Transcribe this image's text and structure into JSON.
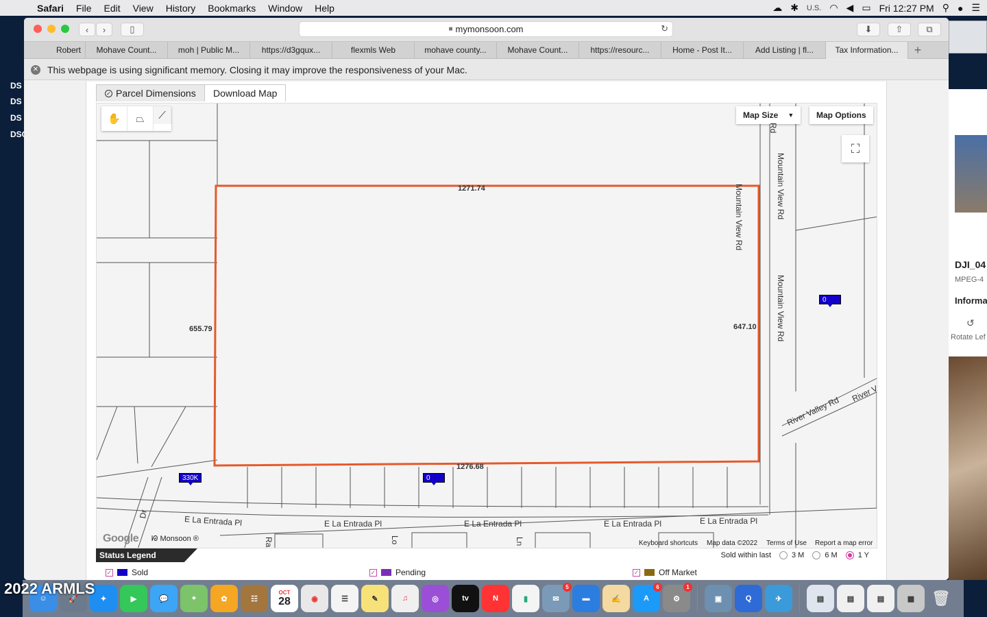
{
  "menubar": {
    "app": "Safari",
    "items": [
      "File",
      "Edit",
      "View",
      "History",
      "Bookmarks",
      "Window",
      "Help"
    ],
    "input_source": "U.S.",
    "clock": "Fri 12:27 PM"
  },
  "desktop": {
    "labels": [
      "DS",
      "DS",
      "DS",
      "DSC"
    ],
    "watermark": "2022 ARMLS"
  },
  "browser": {
    "url": "mymonsoon.com",
    "tabs": [
      "Robert",
      "Mohave Count...",
      "moh | Public M...",
      "https://d3gqux...",
      "flexmls Web",
      "mohave county...",
      "Mohave Count...",
      "https://resourc...",
      "Home - Post It...",
      "Add Listing | fl...",
      "Tax Information..."
    ],
    "active_tab_index": 10,
    "notice": "This webpage is using significant memory. Closing it may improve the responsiveness of your Mac."
  },
  "page": {
    "tabs": {
      "parcel_dimensions": "Parcel Dimensions",
      "download_map": "Download Map"
    },
    "map": {
      "map_size": "Map Size",
      "map_options": "Map Options",
      "dimensions": {
        "top": "1271.74",
        "left": "655.79",
        "right": "647.10",
        "bottom": "1276.68"
      },
      "roads": {
        "mountain_view_1": "Mountain View Rd",
        "mountain_view_2": "Mountain View Rd",
        "mountain_view_top": "Rd",
        "river_valley": "River Valley Rd",
        "river_v": "River V",
        "la_entrada_1": "E La Entrada Pl",
        "la_entrada_2": "E La Entrada Pl",
        "la_entrada_3": "E La Entrada Pl",
        "la_entrada_4": "E La Entrada Pl",
        "la_entrada_5": "E La Entrada Pl",
        "side_dr": "Dr",
        "side_ra": "Ra",
        "side_lo": "Lo",
        "side_ln": "Ln"
      },
      "markers": {
        "price_marker": "330K",
        "zero_marker_1": "0",
        "zero_marker_2": "0"
      },
      "attribution": {
        "google": "Google",
        "monsoon": "Monsoon ®",
        "keyboard": "Keyboard shortcuts",
        "map_data": "Map data ©2022",
        "terms": "Terms of Use",
        "report": "Report a map error"
      },
      "parcel_color": "#e5592b"
    },
    "legend": {
      "title": "Status Legend",
      "sold_within": "Sold within last",
      "options": [
        "3 M",
        "6 M",
        "1 Y"
      ],
      "selected": "1 Y",
      "statuses": [
        {
          "label": "Sold",
          "color": "#1200c8"
        },
        {
          "label": "Pending",
          "color": "#7a2fb8"
        },
        {
          "label": "Off Market",
          "color": "#8a6a10"
        }
      ]
    }
  },
  "preview": {
    "filename": "DJI_04",
    "type": "MPEG-4",
    "info": "Informa",
    "rotate": "Rotate Lef"
  },
  "dock": {
    "badges": {
      "mail": "5",
      "appstore": "6",
      "prefs": "1"
    },
    "calendar_month": "OCT",
    "calendar_day": "28"
  }
}
